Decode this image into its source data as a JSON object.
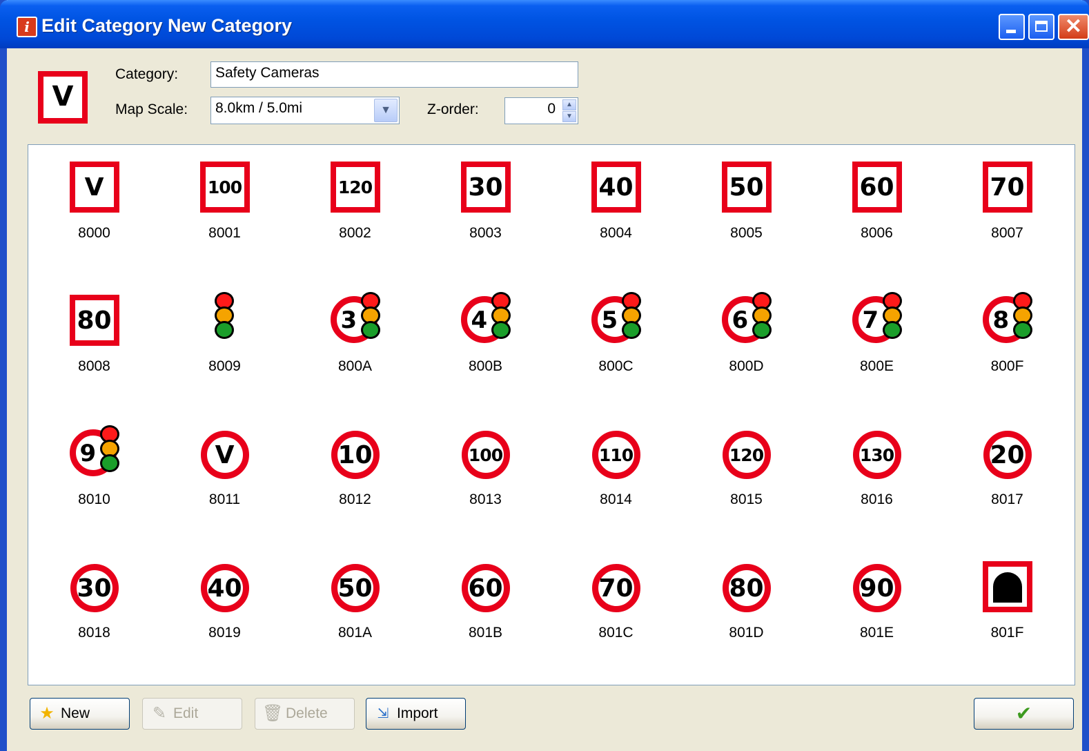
{
  "window": {
    "title": "Edit Category New Category",
    "app_icon": "info-icon"
  },
  "header": {
    "preview_symbol": "V",
    "category_label": "Category:",
    "category_value": "Safety Cameras",
    "map_scale_label": "Map Scale:",
    "map_scale_value": "8.0km / 5.0mi",
    "zorder_label": "Z-order:",
    "zorder_value": "0"
  },
  "icons": [
    {
      "code": "8000",
      "kind": "square",
      "text": "V"
    },
    {
      "code": "8001",
      "kind": "square",
      "text": "100"
    },
    {
      "code": "8002",
      "kind": "square",
      "text": "120"
    },
    {
      "code": "8003",
      "kind": "square",
      "text": "30"
    },
    {
      "code": "8004",
      "kind": "square",
      "text": "40"
    },
    {
      "code": "8005",
      "kind": "square",
      "text": "50"
    },
    {
      "code": "8006",
      "kind": "square",
      "text": "60"
    },
    {
      "code": "8007",
      "kind": "square",
      "text": "70"
    },
    {
      "code": "8008",
      "kind": "square",
      "text": "80"
    },
    {
      "code": "8009",
      "kind": "traffic-light",
      "text": ""
    },
    {
      "code": "800A",
      "kind": "circle-light",
      "text": "3"
    },
    {
      "code": "800B",
      "kind": "circle-light",
      "text": "4"
    },
    {
      "code": "800C",
      "kind": "circle-light",
      "text": "5"
    },
    {
      "code": "800D",
      "kind": "circle-light",
      "text": "6"
    },
    {
      "code": "800E",
      "kind": "circle-light",
      "text": "7"
    },
    {
      "code": "800F",
      "kind": "circle-light",
      "text": "8"
    },
    {
      "code": "8010",
      "kind": "circle-light",
      "text": "9"
    },
    {
      "code": "8011",
      "kind": "circle",
      "text": "V"
    },
    {
      "code": "8012",
      "kind": "circle",
      "text": "10"
    },
    {
      "code": "8013",
      "kind": "circle",
      "text": "100"
    },
    {
      "code": "8014",
      "kind": "circle",
      "text": "110"
    },
    {
      "code": "8015",
      "kind": "circle",
      "text": "120"
    },
    {
      "code": "8016",
      "kind": "circle",
      "text": "130"
    },
    {
      "code": "8017",
      "kind": "circle",
      "text": "20"
    },
    {
      "code": "8018",
      "kind": "circle",
      "text": "30"
    },
    {
      "code": "8019",
      "kind": "circle",
      "text": "40"
    },
    {
      "code": "801A",
      "kind": "circle",
      "text": "50"
    },
    {
      "code": "801B",
      "kind": "circle",
      "text": "60"
    },
    {
      "code": "801C",
      "kind": "circle",
      "text": "70"
    },
    {
      "code": "801D",
      "kind": "circle",
      "text": "80"
    },
    {
      "code": "801E",
      "kind": "circle",
      "text": "90"
    },
    {
      "code": "801F",
      "kind": "tunnel",
      "text": ""
    }
  ],
  "buttons": {
    "new": "New",
    "edit": "Edit",
    "delete": "Delete",
    "import": "Import",
    "ok_icon": "checkmark-icon"
  },
  "colors": {
    "sign_red": "#e8001a",
    "title_blue": "#0054e3",
    "dialog_bg": "#ece9d8"
  }
}
